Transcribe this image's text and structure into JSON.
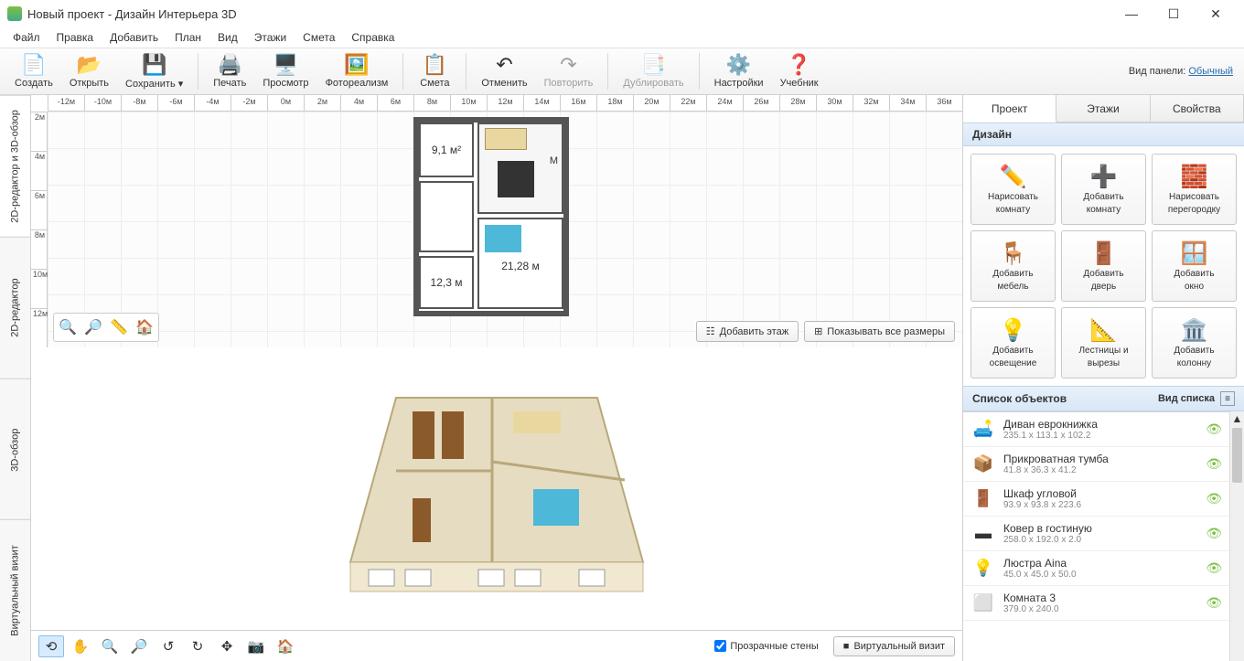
{
  "title": "Новый проект - Дизайн Интерьера 3D",
  "menus": [
    "Файл",
    "Правка",
    "Добавить",
    "План",
    "Вид",
    "Этажи",
    "Смета",
    "Справка"
  ],
  "toolbar": [
    {
      "label": "Создать",
      "icon": "📄",
      "group": 0
    },
    {
      "label": "Открыть",
      "icon": "📂",
      "group": 0
    },
    {
      "label": "Сохранить",
      "icon": "💾",
      "group": 0,
      "dropdown": true
    },
    {
      "label": "Печать",
      "icon": "🖨️",
      "group": 1
    },
    {
      "label": "Просмотр",
      "icon": "🖥️",
      "group": 1
    },
    {
      "label": "Фотореализм",
      "icon": "🖼️",
      "group": 1
    },
    {
      "label": "Смета",
      "icon": "📋",
      "group": 2
    },
    {
      "label": "Отменить",
      "icon": "↶",
      "group": 3
    },
    {
      "label": "Повторить",
      "icon": "↷",
      "group": 3,
      "disabled": true
    },
    {
      "label": "Дублировать",
      "icon": "📑",
      "group": 4,
      "disabled": true
    },
    {
      "label": "Настройки",
      "icon": "⚙️",
      "group": 5
    },
    {
      "label": "Учебник",
      "icon": "❓",
      "group": 5
    }
  ],
  "panel_mode": {
    "label": "Вид панели:",
    "value": "Обычный"
  },
  "left_tabs": [
    "2D-редактор и 3D-обзор",
    "2D-редактор",
    "3D-обзор",
    "Виртуальный визит"
  ],
  "ruler_h": [
    "-12м",
    "-10м",
    "-8м",
    "-6м",
    "-4м",
    "-2м",
    "0м",
    "2м",
    "4м",
    "6м",
    "8м",
    "10м",
    "12м",
    "14м",
    "16м",
    "18м",
    "20м",
    "22м",
    "24м",
    "26м",
    "28м",
    "30м",
    "32м",
    "34м",
    "36м"
  ],
  "ruler_v": [
    "2м",
    "4м",
    "6м",
    "8м",
    "10м",
    "12м"
  ],
  "rooms_2d": {
    "a": "9,1 м²",
    "b": "М",
    "c": "21,28 м",
    "d": "12,3 м"
  },
  "top_overlay_right": {
    "add_floor": "Добавить этаж",
    "show_dims": "Показывать все размеры"
  },
  "bottom": {
    "transparent": "Прозрачные стены",
    "virtual": "Виртуальный визит"
  },
  "rp_tabs": [
    "Проект",
    "Этажи",
    "Свойства"
  ],
  "section_design": "Дизайн",
  "design_buttons": [
    {
      "l1": "Нарисовать",
      "l2": "комнату",
      "icon": "✏️"
    },
    {
      "l1": "Добавить",
      "l2": "комнату",
      "icon": "➕"
    },
    {
      "l1": "Нарисовать",
      "l2": "перегородку",
      "icon": "🧱"
    },
    {
      "l1": "Добавить",
      "l2": "мебель",
      "icon": "🪑"
    },
    {
      "l1": "Добавить",
      "l2": "дверь",
      "icon": "🚪"
    },
    {
      "l1": "Добавить",
      "l2": "окно",
      "icon": "🪟"
    },
    {
      "l1": "Добавить",
      "l2": "освещение",
      "icon": "💡"
    },
    {
      "l1": "Лестницы и",
      "l2": "вырезы",
      "icon": "📐"
    },
    {
      "l1": "Добавить",
      "l2": "колонну",
      "icon": "🏛️"
    }
  ],
  "section_objects": "Список объектов",
  "list_view_label": "Вид списка",
  "objects": [
    {
      "name": "Диван еврокнижка",
      "dim": "235.1 x 113.1 x 102.2",
      "icon": "🛋️"
    },
    {
      "name": "Прикроватная тумба",
      "dim": "41.8 x 36.3 x 41.2",
      "icon": "📦"
    },
    {
      "name": "Шкаф угловой",
      "dim": "93.9 x 93.8 x 223.6",
      "icon": "🚪"
    },
    {
      "name": "Ковер в гостиную",
      "dim": "258.0 x 192.0 x 2.0",
      "icon": "▬"
    },
    {
      "name": "Люстра Aina",
      "dim": "45.0 x 45.0 x 50.0",
      "icon": "💡"
    },
    {
      "name": "Комната 3",
      "dim": "379.0 x 240.0",
      "icon": "⬜"
    }
  ]
}
